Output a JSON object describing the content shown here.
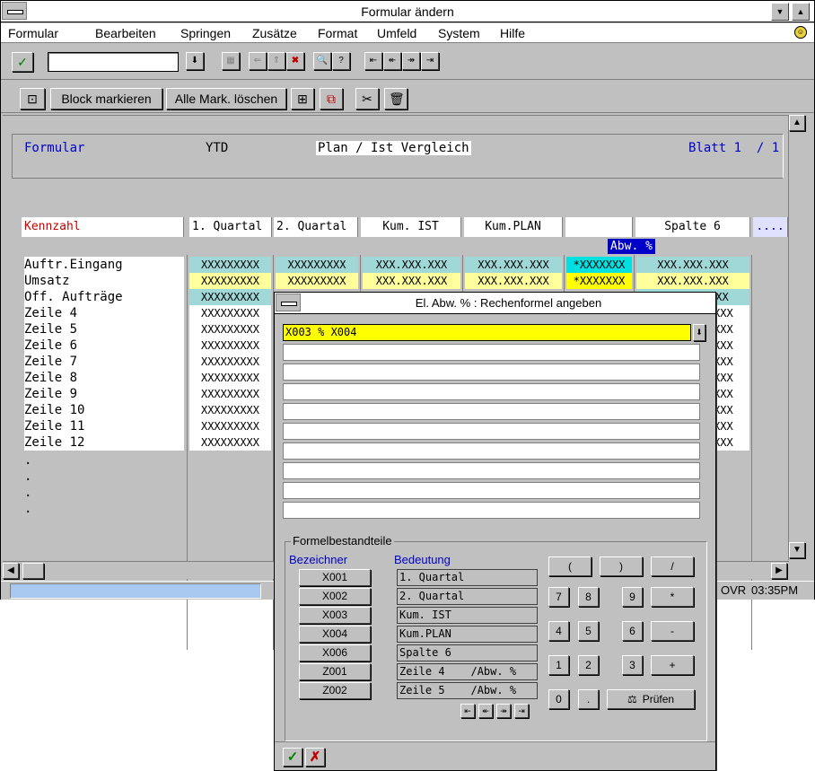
{
  "window": {
    "title": "Formular ändern",
    "menu": [
      "Formular",
      "Bearbeiten",
      "Springen",
      "Zusätze",
      "Format",
      "Umfeld",
      "System",
      "Hilfe"
    ],
    "command_field_value": ""
  },
  "toolbar2": {
    "block_mark_label": "Block markieren",
    "delete_marks_label": "Alle Mark. löschen"
  },
  "header": {
    "formular_label": "Formular",
    "ytd": "YTD",
    "description": "Plan / Ist Vergleich",
    "page": "Blatt 1  / 1"
  },
  "columns": {
    "kennzahl": "Kennzahl",
    "c1": "1. Quartal",
    "c2": "2. Quartal",
    "c3": "Kum. IST",
    "c4": "Kum.PLAN",
    "c5": "Abw. %",
    "c6": "Spalte 6",
    "more": "...."
  },
  "rows": [
    "Auftr.Eingang",
    "Umsatz",
    "Off. Aufträge",
    "Zeile 4",
    "Zeile 5",
    "Zeile 6",
    "Zeile 7",
    "Zeile 8",
    "Zeile 9",
    "Zeile 10",
    "Zeile 11",
    "Zeile 12",
    ".",
    ".",
    ".",
    "."
  ],
  "cells": {
    "quarter": "XXXXXXXXX",
    "amount": "XXX.XXX.XXX",
    "abw": "*XXXXXXX",
    "partial": "XXX"
  },
  "status": {
    "mode": "OVR",
    "time": "03:35PM"
  },
  "dialog": {
    "title": "El. Abw. %   : Rechenformel angeben",
    "formula_lines": [
      "X003 % X004",
      "",
      "",
      "",
      "",
      "",
      "",
      "",
      "",
      ""
    ],
    "group_title": "Formelbestandteile",
    "col_identifier": "Bezeichner",
    "col_meaning": "Bedeutung",
    "components": [
      {
        "id": "X001",
        "meaning": "1. Quartal"
      },
      {
        "id": "X002",
        "meaning": "2. Quartal"
      },
      {
        "id": "X003",
        "meaning": "Kum. IST"
      },
      {
        "id": "X004",
        "meaning": "Kum.PLAN"
      },
      {
        "id": "X006",
        "meaning": "Spalte 6"
      },
      {
        "id": "Z001",
        "meaning": "Zeile 4    /Abw. %"
      },
      {
        "id": "Z002",
        "meaning": "Zeile 5    /Abw. %"
      }
    ],
    "keys": {
      "open_paren": "(",
      "close_paren": ")",
      "divide": "/",
      "k7": "7",
      "k8": "8",
      "k9": "9",
      "multiply": "*",
      "k4": "4",
      "k5": "5",
      "k6": "6",
      "minus": "-",
      "k1": "1",
      "k2": "2",
      "k3": "3",
      "plus": "+",
      "k0": "0",
      "dot": "."
    },
    "check_label": "Prüfen"
  },
  "colors": {
    "cyan_cell": "#a0d8d8",
    "yellow_cell": "#ffff9c",
    "highlight_header": "#0000c8",
    "red_label": "#c80000",
    "blue_label": "#0000c8"
  }
}
